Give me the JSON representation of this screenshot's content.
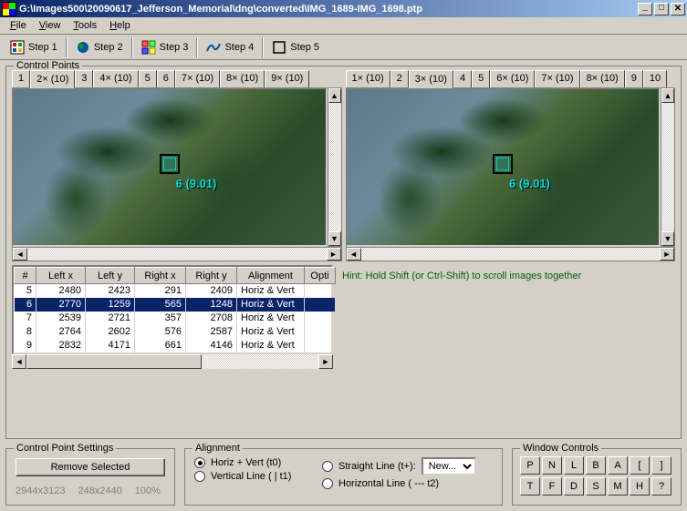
{
  "window": {
    "title": "G:\\Images500\\20090617_Jefferson_Memorial\\dng\\converted\\IMG_1689-IMG_1698.ptp"
  },
  "menu": {
    "file": "File",
    "view": "View",
    "tools": "Tools",
    "help": "Help"
  },
  "toolbar": {
    "step1": "Step 1",
    "step2": "Step 2",
    "step3": "Step 3",
    "step4": "Step 4",
    "step5": "Step 5"
  },
  "control_points": {
    "legend": "Control Points",
    "left_tabs": [
      "1",
      "2× (10)",
      "3",
      "4× (10)",
      "5",
      "6",
      "7× (10)",
      "8× (10)",
      "9× (10)"
    ],
    "left_active": 1,
    "right_tabs": [
      "1× (10)",
      "2",
      "3× (10)",
      "4",
      "5",
      "6× (10)",
      "7× (10)",
      "8× (10)",
      "9",
      "10"
    ],
    "right_active": 2,
    "cp_label_left": "6 (9.01)",
    "cp_label_right": "6 (9.01)",
    "hint": "Hint: Hold Shift (or Ctrl-Shift) to scroll images together",
    "table": {
      "headers": [
        "#",
        "Left x",
        "Left y",
        "Right x",
        "Right y",
        "Alignment",
        "Opti"
      ],
      "rows": [
        {
          "n": "5",
          "lx": "2480",
          "ly": "2423",
          "rx": "291",
          "ry": "2409",
          "al": "Horiz & Vert",
          "sel": false
        },
        {
          "n": "6",
          "lx": "2770",
          "ly": "1259",
          "rx": "565",
          "ry": "1248",
          "al": "Horiz & Vert",
          "sel": true
        },
        {
          "n": "7",
          "lx": "2539",
          "ly": "2721",
          "rx": "357",
          "ry": "2708",
          "al": "Horiz & Vert",
          "sel": false
        },
        {
          "n": "8",
          "lx": "2764",
          "ly": "2602",
          "rx": "576",
          "ry": "2587",
          "al": "Horiz & Vert",
          "sel": false
        },
        {
          "n": "9",
          "lx": "2832",
          "ly": "4171",
          "rx": "661",
          "ry": "4146",
          "al": "Horiz & Vert",
          "sel": false
        }
      ]
    }
  },
  "cp_settings": {
    "legend": "Control Point Settings",
    "remove": "Remove Selected",
    "dim1": "2944x3123",
    "dim2": "248x2440",
    "zoom": "100%"
  },
  "alignment": {
    "legend": "Alignment",
    "horiz_vert": "Horiz + Vert (t0)",
    "straight": "Straight Line (t+):",
    "vertical": "Vertical Line ( | t1)",
    "horizontal": "Horizontal Line ( --- t2)",
    "combo": "New..."
  },
  "window_controls": {
    "legend": "Window Controls",
    "row1": [
      "P",
      "N",
      "L",
      "B",
      "A",
      "[",
      "]"
    ],
    "row2": [
      "T",
      "F",
      "D",
      "S",
      "M",
      "H",
      "?"
    ]
  }
}
